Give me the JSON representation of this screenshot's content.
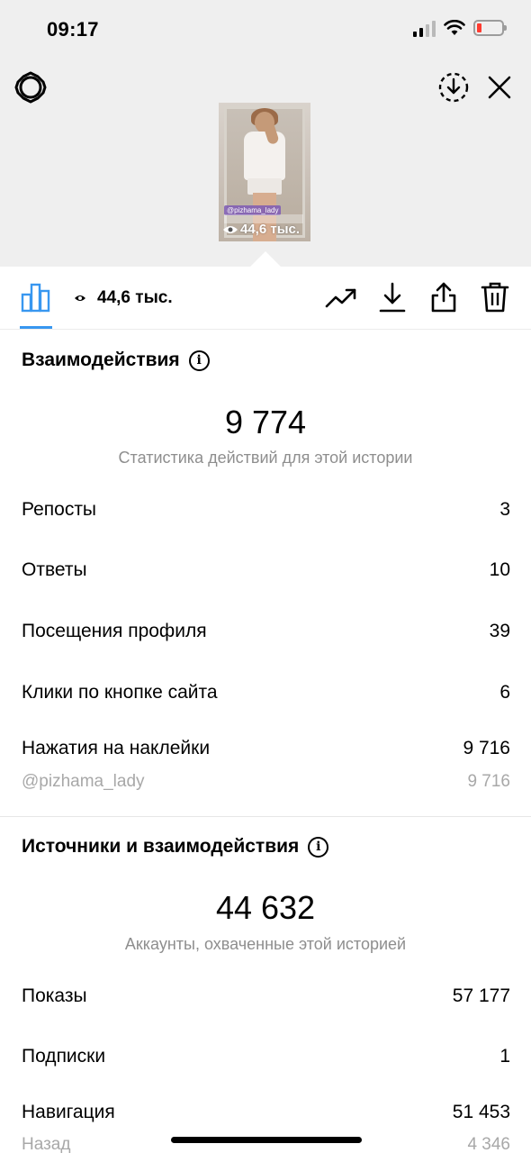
{
  "status_bar": {
    "time": "09:17",
    "icons": [
      "signal-icon",
      "wifi-icon",
      "battery-low-icon"
    ],
    "battery_color": "#ff3b30"
  },
  "header": {
    "left_icon": "settings-gear-icon",
    "right_icons": [
      "download-icon",
      "close-icon"
    ]
  },
  "story_thumbnail": {
    "mention": "@pizhama_lady",
    "views": "44,6 тыс."
  },
  "toolbar": {
    "views_label": "44,6 тыс.",
    "icons": [
      "insights-bar-chart-icon",
      "eye-icon",
      "promote-trend-icon",
      "save-download-icon",
      "share-icon",
      "delete-trash-icon"
    ],
    "active_tab_color": "#3897f0"
  },
  "interactions": {
    "title": "Взаимодействия",
    "total": "9 774",
    "caption": "Статистика действий для этой истории",
    "rows": [
      {
        "label": "Репосты",
        "value": "3"
      },
      {
        "label": "Ответы",
        "value": "10"
      },
      {
        "label": "Посещения профиля",
        "value": "39"
      },
      {
        "label": "Клики по кнопке сайта",
        "value": "6"
      },
      {
        "label": "Нажатия на наклейки",
        "value": "9 716"
      }
    ],
    "sticker_sub": {
      "label": "@pizhama_lady",
      "value": "9 716"
    }
  },
  "discovery": {
    "title": "Источники и взаимодействия",
    "total": "44 632",
    "caption": "Аккаунты, охваченные этой историей",
    "rows": [
      {
        "label": "Показы",
        "value": "57 177"
      },
      {
        "label": "Подписки",
        "value": "1"
      },
      {
        "label": "Навигация",
        "value": "51 453"
      }
    ],
    "navigation_sub": {
      "label": "Назад",
      "value": "4 346"
    }
  }
}
